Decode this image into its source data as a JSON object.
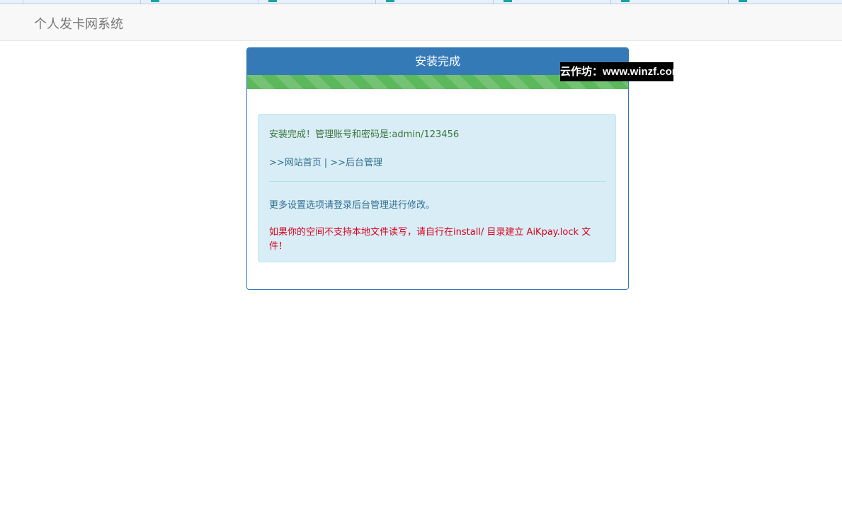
{
  "navbar": {
    "brand": "个人发卡网系统"
  },
  "panel": {
    "title": "安装完成",
    "progress_percent": 100,
    "progress_color": "#5cb85c",
    "success_message": "安装完成！管理账号和密码是:admin/123456",
    "link_home": ">>网站首页",
    "link_separator": "|",
    "link_admin": ">>后台管理",
    "more_settings": "更多设置选项请登录后台管理进行修改。",
    "warning": "如果你的空间不支持本地文件读写，请自行在install/ 目录建立 AiKpay.lock 文件！"
  },
  "watermark": {
    "text": "云作坊：www.winzf.com"
  },
  "colors": {
    "primary": "#337ab7",
    "success_text": "#3c763d",
    "info_bg": "#d9edf7",
    "info_text": "#31708f",
    "warning_text": "#d9001b"
  }
}
